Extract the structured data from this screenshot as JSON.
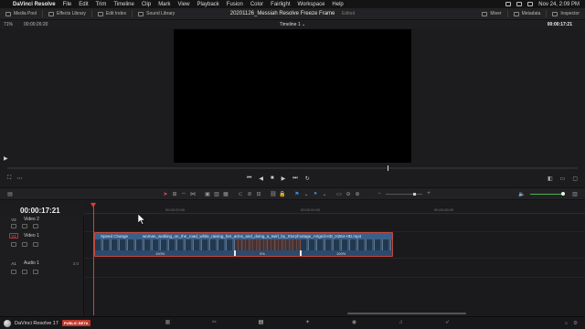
{
  "menubar": {
    "app_name": "DaVinci Resolve",
    "items": [
      "File",
      "Edit",
      "Trim",
      "Timeline",
      "Clip",
      "Mark",
      "View",
      "Playback",
      "Fusion",
      "Color",
      "Fairlight",
      "Workspace",
      "Help"
    ],
    "clock": "Nov 24, 2:09 PM"
  },
  "header": {
    "media_pool": "Media Pool",
    "effects_library": "Effects Library",
    "edit_index": "Edit Index",
    "sound_library": "Sound Library",
    "project_title": "20201126_Messiah Resolve Freeze Frame",
    "edited_label": "Edited",
    "mixer": "Mixer",
    "metadata": "Metadata",
    "inspector": "Inspector"
  },
  "viewer": {
    "zoom": "71%",
    "source_timecode": "00:00:26:20",
    "timeline_name": "Timeline 1",
    "record_timecode": "00:00:17:21"
  },
  "timeline": {
    "current_timecode": "00:00:17:21",
    "ruler_ticks": [
      "00:00:20:00",
      "00:00:24:00",
      "00:00:28:00"
    ],
    "tracks": [
      {
        "id": "V2",
        "name": "Video 2"
      },
      {
        "id": "V1",
        "name": "Video 1"
      },
      {
        "id": "A1",
        "name": "Audio 1",
        "channel": "2.0"
      }
    ],
    "clip": {
      "effect_label": "Speed Change",
      "file_name": "woman_walking_on_the_road_while_raising_her_arms_and_doing_a_twirl_by_Storyfootage_Artgrid-HD_H264-HD.mp4",
      "speeds": [
        "100%",
        "0%",
        "100%"
      ]
    }
  },
  "pagebar": {
    "brand": "DaVinci Resolve 17",
    "beta_badge": "PUBLIC BETA"
  },
  "colors": {
    "accent_red": "#e03b3b",
    "clip_blue": "#2c4a6e",
    "tool_blue": "#3c8ce0"
  }
}
